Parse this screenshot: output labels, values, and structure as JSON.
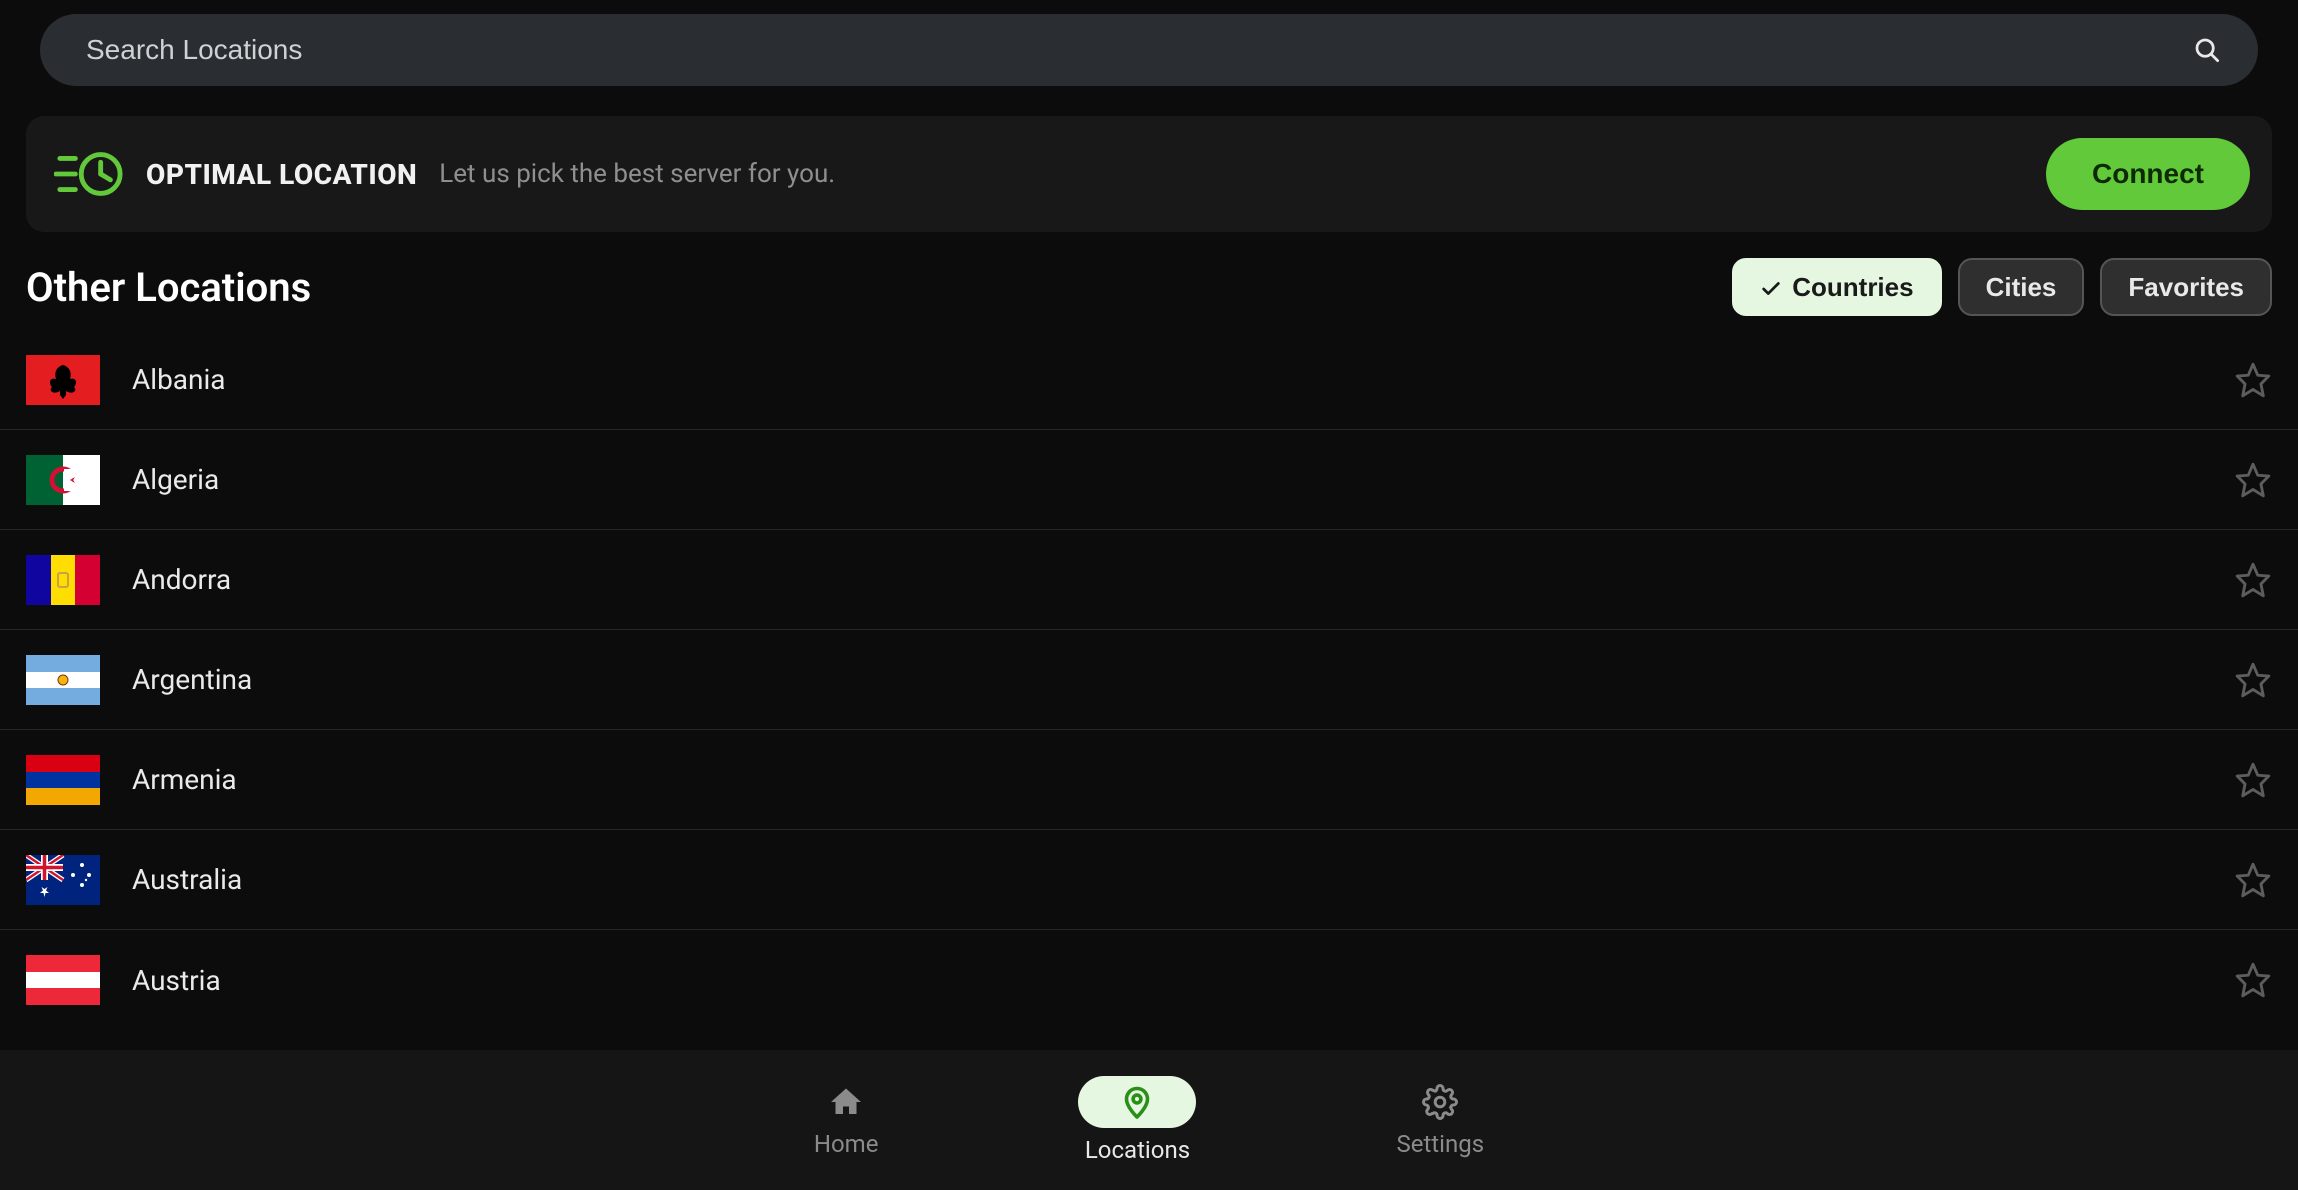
{
  "search": {
    "placeholder": "Search Locations",
    "value": ""
  },
  "optimal": {
    "title": "OPTIMAL LOCATION",
    "subtitle": "Let us pick the best server for you.",
    "connect_label": "Connect"
  },
  "section": {
    "title": "Other Locations"
  },
  "tabs": {
    "countries": "Countries",
    "cities": "Cities",
    "favorites": "Favorites",
    "active": "countries"
  },
  "countries": [
    {
      "name": "Albania",
      "code": "al",
      "favorite": false
    },
    {
      "name": "Algeria",
      "code": "dz",
      "favorite": false
    },
    {
      "name": "Andorra",
      "code": "ad",
      "favorite": false
    },
    {
      "name": "Argentina",
      "code": "ar",
      "favorite": false
    },
    {
      "name": "Armenia",
      "code": "am",
      "favorite": false
    },
    {
      "name": "Australia",
      "code": "au",
      "favorite": false
    },
    {
      "name": "Austria",
      "code": "at",
      "favorite": false
    }
  ],
  "nav": {
    "home": "Home",
    "locations": "Locations",
    "settings": "Settings",
    "active": "locations"
  },
  "colors": {
    "accent": "#62c93a",
    "bg": "#0c0c0c"
  }
}
